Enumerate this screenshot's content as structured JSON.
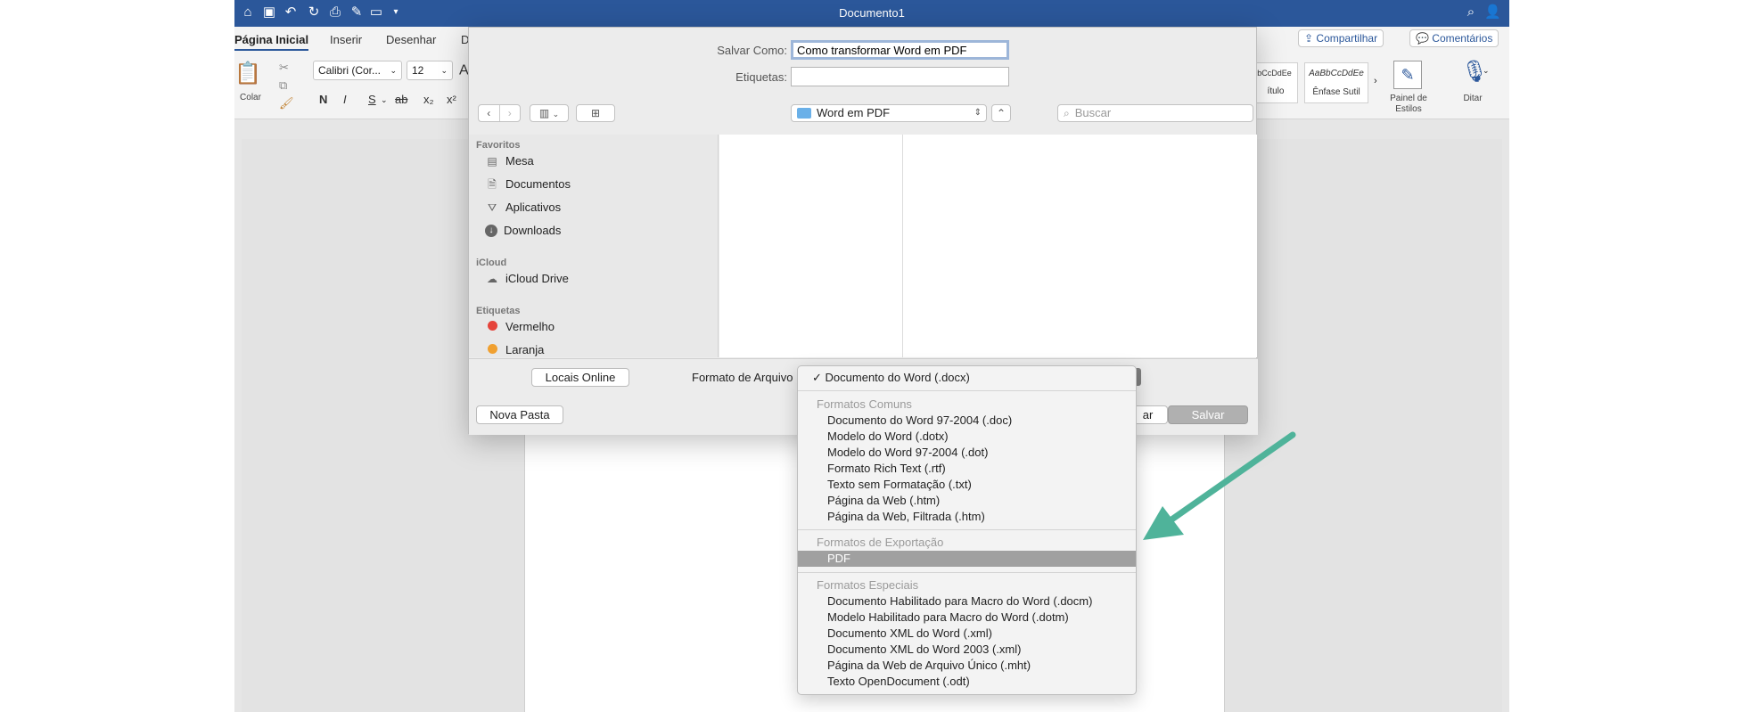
{
  "window": {
    "title": "Documento1"
  },
  "ribbon": {
    "tabs": [
      "Página Inicial",
      "Inserir",
      "Desenhar",
      "D"
    ],
    "share_label": "Compartilhar",
    "comments_label": "Comentários",
    "paste_label": "Colar",
    "font_name": "Calibri (Cor...",
    "font_size": "12",
    "bold": "N",
    "italic": "I",
    "underline": "S",
    "strike": "ab",
    "subscript": "x₂",
    "superscript": "x²",
    "style_preview_1": "AaBbCcDdEe",
    "style_label_1": "ítulo",
    "style_preview_2": "AaBbCcDdEe",
    "style_label_2": "Ênfase Sutil",
    "styles_pane_line1": "Painel de",
    "styles_pane_line2": "Estilos",
    "dictate_label": "Ditar"
  },
  "dialog": {
    "save_as_label": "Salvar Como:",
    "save_as_value": "Como transformar Word em PDF",
    "tags_label": "Etiquetas:",
    "tags_value": "",
    "location": "Word em PDF",
    "search_placeholder": "Buscar",
    "sidebar": {
      "favorites_title": "Favoritos",
      "favorites": [
        "Mesa",
        "Documentos",
        "Aplicativos",
        "Downloads"
      ],
      "icloud_title": "iCloud",
      "icloud": [
        "iCloud Drive"
      ],
      "tags_title": "Etiquetas",
      "tags": [
        "Vermelho",
        "Laranja"
      ]
    },
    "online_locations_label": "Locais Online",
    "file_format_label": "Formato de Arquivo",
    "new_folder_label": "Nova Pasta",
    "cancel_partial": "ar",
    "save_label": "Salvar"
  },
  "menu": {
    "checked_item": "Documento do Word (.docx)",
    "check_mark": "✓",
    "groups": [
      {
        "header": "Formatos Comuns",
        "items": [
          "Documento do Word 97-2004 (.doc)",
          "Modelo do Word (.dotx)",
          "Modelo do Word 97-2004 (.dot)",
          "Formato Rich Text (.rtf)",
          "Texto sem Formatação (.txt)",
          "Página da Web (.htm)",
          "Página da Web, Filtrada (.htm)"
        ]
      },
      {
        "header": "Formatos de Exportação",
        "items": [
          "PDF"
        ]
      },
      {
        "header": "Formatos Especiais",
        "items": [
          "Documento Habilitado para Macro do Word (.docm)",
          "Modelo Habilitado para Macro do Word (.dotm)",
          "Documento XML do Word (.xml)",
          "Documento XML do Word 2003 (.xml)",
          "Página da Web de Arquivo Único (.mht)",
          "Texto OpenDocument (.odt)"
        ]
      }
    ],
    "selected_item": "PDF"
  },
  "colors": {
    "word_blue": "#2b579a",
    "arrow": "#4fb39a",
    "tag_red": "#e5443b",
    "tag_orange": "#f0a030"
  }
}
